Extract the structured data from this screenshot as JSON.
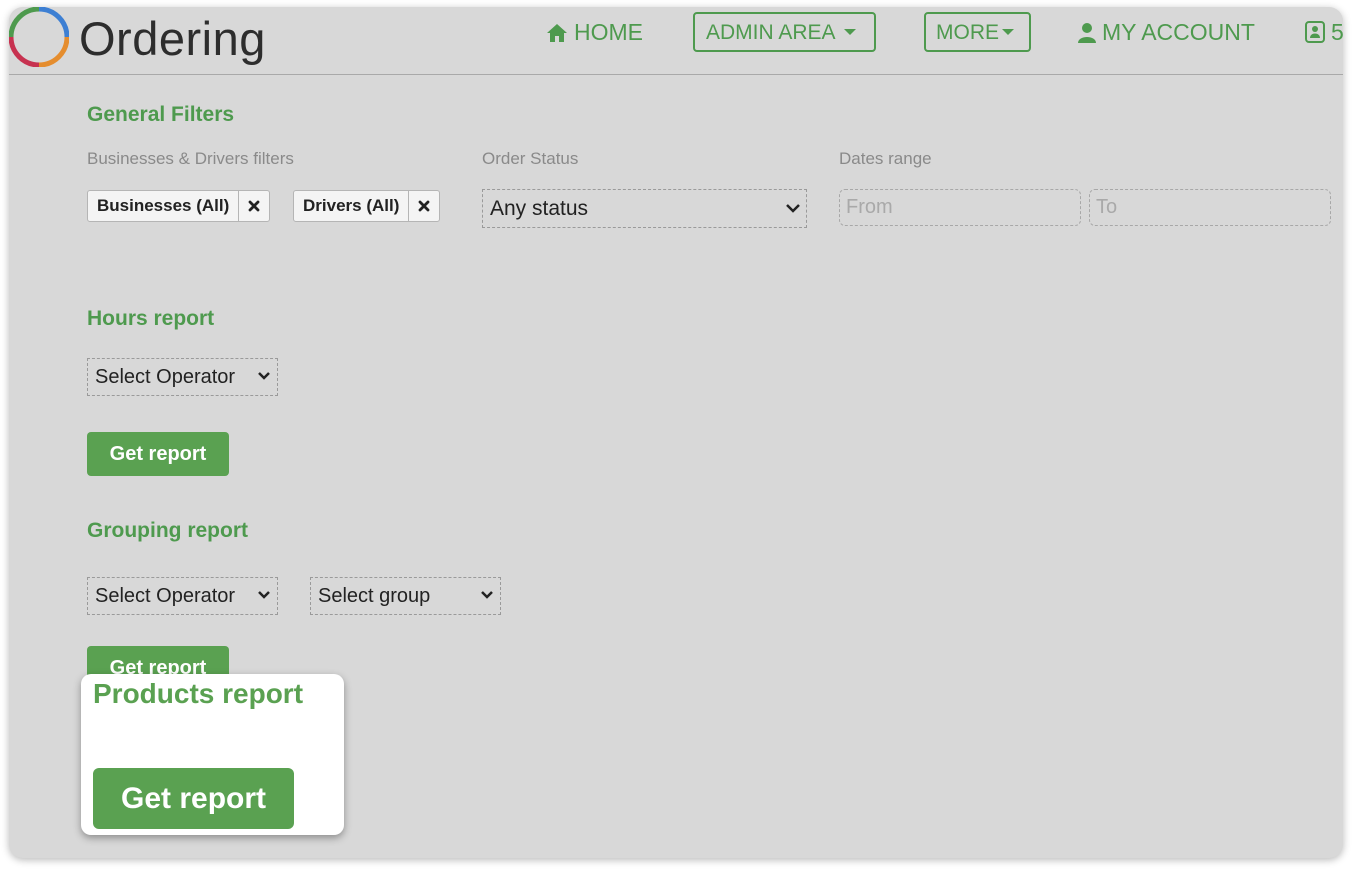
{
  "app": {
    "brand": "Ordering"
  },
  "nav": {
    "home": "HOME",
    "admin_area": "ADMIN AREA",
    "more": "MORE",
    "my_account": "MY ACCOUNT",
    "extra": "5"
  },
  "general_filters": {
    "title": "General Filters",
    "businesses_drivers_label": "Businesses & Drivers filters",
    "tags": [
      {
        "label": "Businesses (All)"
      },
      {
        "label": "Drivers (All)"
      }
    ],
    "order_status_label": "Order Status",
    "order_status_value": "Any status",
    "dates_range_label": "Dates range",
    "from_placeholder": "From",
    "to_placeholder": "To"
  },
  "hours_report": {
    "title": "Hours report",
    "operator_select": "Select Operator",
    "button": "Get report"
  },
  "grouping_report": {
    "title": "Grouping report",
    "operator_select": "Select Operator",
    "group_select": "Select group",
    "button": "Get report"
  },
  "products_report": {
    "title": "Products report",
    "button": "Get report"
  },
  "colors": {
    "accent_green": "#4e9a4e",
    "button_green": "#5aa151",
    "background": "#d8d8d8"
  }
}
